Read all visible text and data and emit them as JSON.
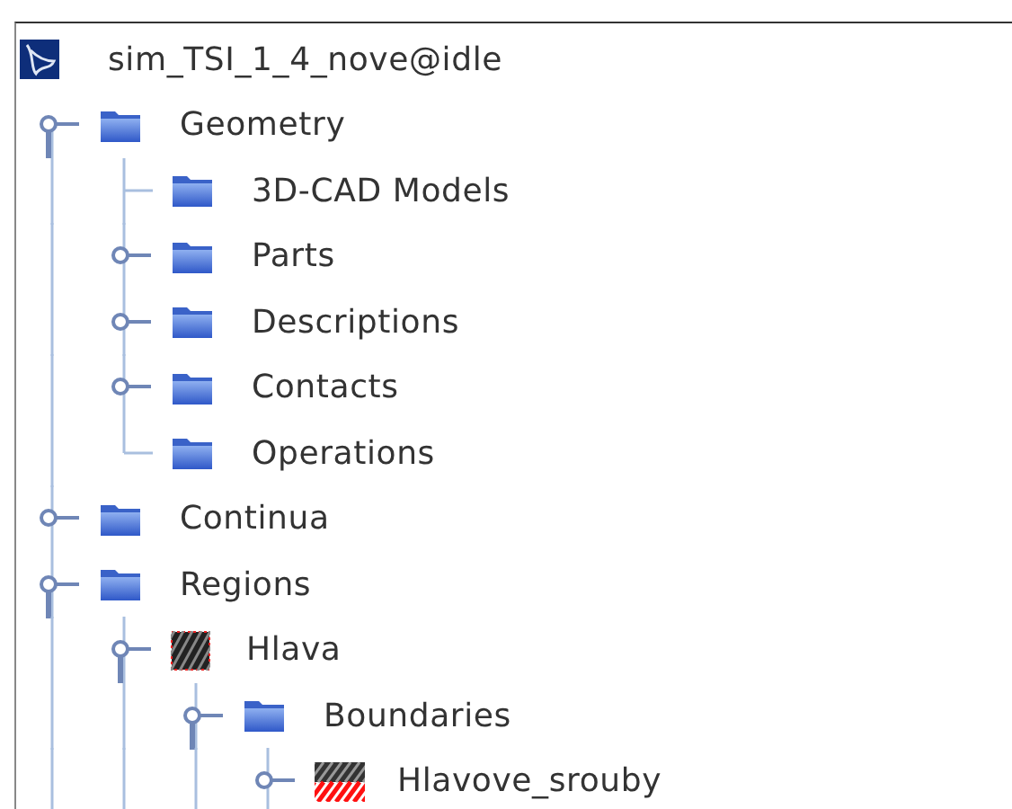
{
  "root": {
    "label": "sim_TSI_1_4_nove@idle",
    "children": [
      {
        "label": "Geometry",
        "kind": "folder",
        "expanded": true,
        "children": [
          {
            "label": "3D-CAD Models",
            "kind": "folder"
          },
          {
            "label": "Parts",
            "kind": "folder",
            "expanded": false
          },
          {
            "label": "Descriptions",
            "kind": "folder",
            "expanded": false
          },
          {
            "label": "Contacts",
            "kind": "folder",
            "expanded": false
          },
          {
            "label": "Operations",
            "kind": "folder"
          }
        ]
      },
      {
        "label": "Continua",
        "kind": "folder",
        "expanded": false
      },
      {
        "label": "Regions",
        "kind": "folder",
        "expanded": true,
        "children": [
          {
            "label": "Hlava",
            "kind": "region",
            "expanded": true,
            "children": [
              {
                "label": "Boundaries",
                "kind": "folder",
                "expanded": true,
                "children": [
                  {
                    "label": "Hlavove_srouby",
                    "kind": "boundary",
                    "expanded": false
                  }
                ]
              }
            ]
          }
        ]
      }
    ]
  }
}
